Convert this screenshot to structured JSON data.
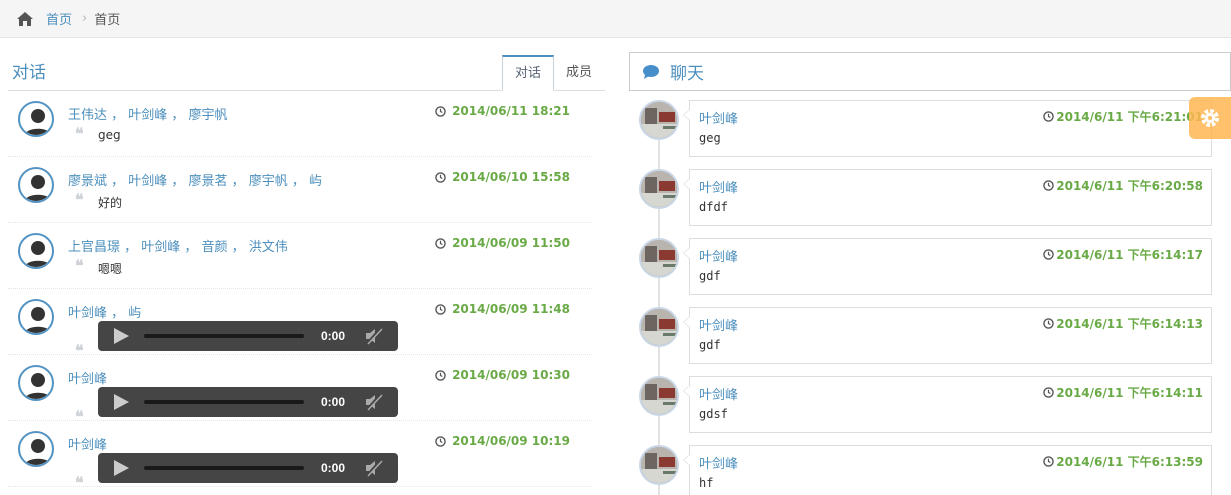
{
  "breadcrumb": {
    "home": "首页",
    "current": "首页"
  },
  "left_panel": {
    "title": "对话",
    "tabs": [
      {
        "label": "对话",
        "active": true
      },
      {
        "label": "成员",
        "active": false
      }
    ],
    "conversations": [
      {
        "participants": "王伟达 ， 叶剑峰 ， 廖宇帆",
        "time": "2014/06/11 18:21",
        "preview": "geg",
        "audio": false
      },
      {
        "participants": "廖景斌 ， 叶剑峰 ， 廖景茗 ， 廖宇帆 ， 屿",
        "time": "2014/06/10 15:58",
        "preview": "好的",
        "audio": false
      },
      {
        "participants": "上官昌璟 ， 叶剑峰 ， 音颜 ， 洪文伟",
        "time": "2014/06/09 11:50",
        "preview": "嗯嗯",
        "audio": false
      },
      {
        "participants": "叶剑峰 ， 屿",
        "time": "2014/06/09 11:48",
        "preview": "",
        "audio": true,
        "audio_time": "0:00"
      },
      {
        "participants": "叶剑峰",
        "time": "2014/06/09 10:30",
        "preview": "",
        "audio": true,
        "audio_time": "0:00"
      },
      {
        "participants": "叶剑峰",
        "time": "2014/06/09 10:19",
        "preview": "",
        "audio": true,
        "audio_time": "0:00"
      }
    ]
  },
  "chat_panel": {
    "title": "聊天",
    "messages": [
      {
        "user": "叶剑峰",
        "time": "2014/6/11 下午6:21:01",
        "text": "geg"
      },
      {
        "user": "叶剑峰",
        "time": "2014/6/11 下午6:20:58",
        "text": "dfdf"
      },
      {
        "user": "叶剑峰",
        "time": "2014/6/11 下午6:14:17",
        "text": "gdf"
      },
      {
        "user": "叶剑峰",
        "time": "2014/6/11 下午6:14:13",
        "text": "gdf"
      },
      {
        "user": "叶剑峰",
        "time": "2014/6/11 下午6:14:11",
        "text": "gdsf"
      },
      {
        "user": "叶剑峰",
        "time": "2014/6/11 下午6:13:59",
        "text": "hf"
      }
    ]
  },
  "colors": {
    "link": "#4c8fbd",
    "time": "#69aa46",
    "settings": "#ffb752"
  }
}
